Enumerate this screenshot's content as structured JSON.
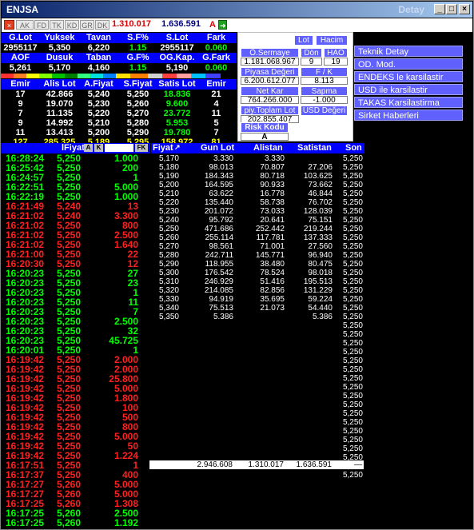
{
  "window": {
    "title": "ENJSA",
    "title_right": "Detay"
  },
  "toolbar": {
    "icons": [
      "AK",
      "FD",
      "TK",
      "KD",
      "GR",
      "DK"
    ],
    "value1": "1.310.017",
    "value2": "1.636.591",
    "a_label": "A"
  },
  "summary": {
    "row1_headers": [
      "G.Lot",
      "Yuksek",
      "Tavan",
      "S.F%",
      "S.Lot",
      "Fark"
    ],
    "row1_values": [
      "2955117",
      "5,350",
      "6,220",
      "1.15",
      "2955117",
      "0.060"
    ],
    "row2_headers": [
      "AOF",
      "Dusuk",
      "Taban",
      "G.F%",
      "OG.Kap.",
      "G.Fark"
    ],
    "row2_values": [
      "5,261",
      "5,170",
      "4,160",
      "1.15",
      "5,190",
      "0.060"
    ]
  },
  "orders": {
    "headers": [
      "Emir",
      "Alis Lot",
      "A.Fiyat",
      "S.Fiyat",
      "Satis Lot",
      "Emir"
    ],
    "rows": [
      [
        "17",
        "42.866",
        "5,240",
        "5,250",
        "18.836",
        "21"
      ],
      [
        "9",
        "19.070",
        "5,230",
        "5,260",
        "9.600",
        "4"
      ],
      [
        "7",
        "11.135",
        "5,220",
        "5,270",
        "23.772",
        "11"
      ],
      [
        "9",
        "14.992",
        "5,210",
        "5,280",
        "5.953",
        "5"
      ],
      [
        "11",
        "13.413",
        "5,200",
        "5,290",
        "19.780",
        "7"
      ],
      [
        "127",
        "285.325",
        "5,189",
        "5,295",
        "158.972",
        "81"
      ]
    ]
  },
  "info_panel": {
    "lot": "Lot",
    "hacim": "Hacim",
    "osermaye_label": "Ö.Sermaye",
    "osermaye_value": "1.181.068.967",
    "don_label": "Dön",
    "don_value": "9",
    "hao_label": "HAO",
    "hao_value": "19",
    "piyasa_label": "Piyasa Değeri",
    "piyasa_value": "6.200.612.077",
    "fk_label": "F / K",
    "fk_value": "8.113",
    "netkar_label": "Net Kar",
    "netkar_value": "764.266.000",
    "sapma_label": "Sapma",
    "sapma_value": "-1.000",
    "piytoplam_label": "piy.Toplam Lot",
    "piytoplam_value": "202.855.407",
    "usd_label": "USD Değeri",
    "risk_label": "Risk Kodu",
    "risk_value": "A"
  },
  "right_menu": [
    "Teknik Detay",
    "OD. Mod.",
    "ENDEKS le karsilastir",
    "USD ile karsilastir",
    "TAKAS Karsilastirma",
    "Sirket Haberleri"
  ],
  "trades": {
    "headers": [
      "lFiyat",
      "A",
      "K",
      "FK"
    ],
    "rows": [
      [
        "16:28:24",
        "5,250",
        "1.000",
        "g"
      ],
      [
        "16:25:42",
        "5,250",
        "200",
        "g"
      ],
      [
        "16:24:57",
        "5,250",
        "1",
        "g"
      ],
      [
        "16:22:51",
        "5,250",
        "5.000",
        "g"
      ],
      [
        "16:22:19",
        "5,250",
        "1.000",
        "g"
      ],
      [
        "16:21:49",
        "5,240",
        "13",
        "r"
      ],
      [
        "16:21:02",
        "5,240",
        "3.300",
        "r"
      ],
      [
        "16:21:02",
        "5,250",
        "800",
        "r"
      ],
      [
        "16:21:02",
        "5,250",
        "2.500",
        "r"
      ],
      [
        "16:21:02",
        "5,250",
        "1.640",
        "r"
      ],
      [
        "16:21:00",
        "5,250",
        "22",
        "r"
      ],
      [
        "16:20:30",
        "5,250",
        "12",
        "r"
      ],
      [
        "16:20:23",
        "5,250",
        "27",
        "g"
      ],
      [
        "16:20:23",
        "5,250",
        "23",
        "g"
      ],
      [
        "16:20:23",
        "5,250",
        "1",
        "g"
      ],
      [
        "16:20:23",
        "5,250",
        "11",
        "g"
      ],
      [
        "16:20:23",
        "5,250",
        "7",
        "g"
      ],
      [
        "16:20:23",
        "5,250",
        "2.500",
        "g"
      ],
      [
        "16:20:23",
        "5,250",
        "32",
        "g"
      ],
      [
        "16:20:23",
        "5,250",
        "45.725",
        "g"
      ],
      [
        "16:20:01",
        "5,250",
        "1",
        "g"
      ],
      [
        "16:19:42",
        "5,250",
        "2.000",
        "r"
      ],
      [
        "16:19:42",
        "5,250",
        "2.000",
        "r"
      ],
      [
        "16:19:42",
        "5,250",
        "25.800",
        "r"
      ],
      [
        "16:19:42",
        "5,250",
        "5.000",
        "r"
      ],
      [
        "16:19:42",
        "5,250",
        "1.800",
        "r"
      ],
      [
        "16:19:42",
        "5,250",
        "100",
        "r"
      ],
      [
        "16:19:42",
        "5,250",
        "500",
        "r"
      ],
      [
        "16:19:42",
        "5,250",
        "800",
        "r"
      ],
      [
        "16:19:42",
        "5,250",
        "5.000",
        "r"
      ],
      [
        "16:19:42",
        "5,250",
        "50",
        "r"
      ],
      [
        "16:19:42",
        "5,250",
        "1.224",
        "r"
      ],
      [
        "16:17:51",
        "5,250",
        "1",
        "r"
      ],
      [
        "16:17:37",
        "5,250",
        "400",
        "r"
      ],
      [
        "16:17:27",
        "5,260",
        "5.000",
        "r"
      ],
      [
        "16:17:27",
        "5,260",
        "5.000",
        "r"
      ],
      [
        "16:17:25",
        "5,260",
        "1.308",
        "r"
      ],
      [
        "16:17:25",
        "5,260",
        "2.500",
        "g"
      ],
      [
        "16:17:25",
        "5,260",
        "1.192",
        "g"
      ]
    ]
  },
  "depth": {
    "headers": [
      "Fiyat",
      "Gun Lot",
      "Alistan",
      "Satistan",
      "Son"
    ],
    "rows": [
      [
        "5,170",
        "3.330",
        "3.330",
        "",
        "5,250"
      ],
      [
        "5,180",
        "98.013",
        "70.807",
        "27.206",
        "5,250"
      ],
      [
        "5,190",
        "184.343",
        "80.718",
        "103.625",
        "5,250"
      ],
      [
        "5,200",
        "164.595",
        "90.933",
        "73.662",
        "5,250"
      ],
      [
        "5,210",
        "63.622",
        "16.778",
        "46.844",
        "5,250"
      ],
      [
        "5,220",
        "135.440",
        "58.738",
        "76.702",
        "5,250"
      ],
      [
        "5,230",
        "201.072",
        "73.033",
        "128.039",
        "5,250"
      ],
      [
        "5,240",
        "95.792",
        "20.641",
        "75.151",
        "5,250"
      ],
      [
        "5,250",
        "471.686",
        "252.442",
        "219.244",
        "5,250"
      ],
      [
        "5,260",
        "255.114",
        "117.781",
        "137.333",
        "5,250"
      ],
      [
        "5,270",
        "98.561",
        "71.001",
        "27.560",
        "5,250"
      ],
      [
        "5,280",
        "242.711",
        "145.771",
        "96.940",
        "5,250"
      ],
      [
        "5,290",
        "118.955",
        "38.480",
        "80.475",
        "5,250"
      ],
      [
        "5,300",
        "176.542",
        "78.524",
        "98.018",
        "5,250"
      ],
      [
        "5,310",
        "246.929",
        "51.416",
        "195.513",
        "5,250"
      ],
      [
        "5,320",
        "214.085",
        "82.856",
        "131.229",
        "5,250"
      ],
      [
        "5,330",
        "94.919",
        "35.695",
        "59.224",
        "5,250"
      ],
      [
        "5,340",
        "75.513",
        "21.073",
        "54.440",
        "5,250"
      ],
      [
        "5,350",
        "5.386",
        "",
        "5.386",
        "5,250"
      ]
    ],
    "extra_son": [
      "5,250",
      "5,250",
      "5,250",
      "5,250",
      "5,250",
      "5,250",
      "5,250",
      "5,250",
      "5,250",
      "5,250",
      "5,250",
      "5,250",
      "5,250",
      "5,250",
      "5,250",
      "5,250",
      "5,250",
      "5,250"
    ],
    "totals": [
      "2.946.608",
      "1.310.017",
      "1.636.591",
      "—"
    ]
  },
  "colors": {
    "green": "#00ff00",
    "red": "#ff2020",
    "blue": "#0000ff",
    "cyan": "#00ffff",
    "yellow": "#ffff00"
  }
}
